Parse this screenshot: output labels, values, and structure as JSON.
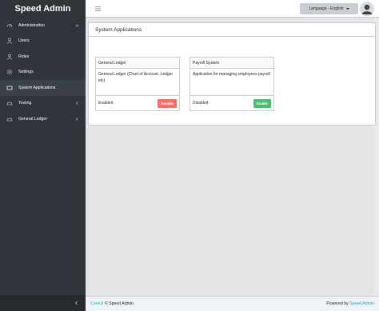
{
  "brand": "Speed Admin",
  "sidebar": {
    "items": [
      {
        "label": "Administration",
        "icon": "speedometer-icon",
        "chevron": true,
        "active": false
      },
      {
        "label": "Users",
        "icon": "user-icon",
        "chevron": false,
        "active": false
      },
      {
        "label": "Roles",
        "icon": "roles-icon",
        "chevron": false,
        "active": false
      },
      {
        "label": "Settings",
        "icon": "gear-icon",
        "chevron": false,
        "active": false
      },
      {
        "label": "System Applications",
        "icon": "layers-icon",
        "chevron": false,
        "active": true
      },
      {
        "label": "Testing",
        "icon": "flask-icon",
        "chevron": true,
        "active": false
      },
      {
        "label": "General Ledger",
        "icon": "ledger-icon",
        "chevron": true,
        "active": false
      }
    ]
  },
  "topbar": {
    "language_label": "Language - English"
  },
  "panel": {
    "title": "System Applications",
    "apps": [
      {
        "name": "General Ledger",
        "description": "General Ledger (Chart of Account, Ledger etc)",
        "status": "Enabled",
        "action": "Disable",
        "action_color": "#f86c6b"
      },
      {
        "name": "Payroll System",
        "description": "Application for managing employees payroll",
        "status": "Disabled",
        "action": "Enable",
        "action_color": "#4dbd74"
      }
    ]
  },
  "footer": {
    "left_link": "CoreUI",
    "left_text": "© Speed Admin.",
    "right_text": "Powered by",
    "right_link": "Speed Admin"
  },
  "colors": {
    "sidebar_bg": "#2f353a",
    "danger": "#f86c6b",
    "success": "#4dbd74",
    "link": "#20a8d8"
  }
}
